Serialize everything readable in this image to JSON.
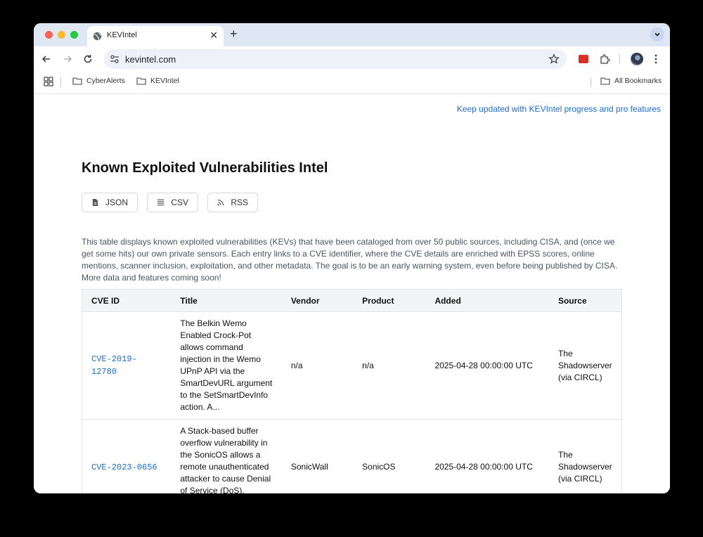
{
  "browser": {
    "tab_title": "KEVIntel",
    "url": "kevintel.com",
    "bookmarks": [
      {
        "label": "CyberAlerts"
      },
      {
        "label": "KEVIntel"
      }
    ],
    "all_bookmarks_label": "All Bookmarks"
  },
  "page": {
    "promo_link": "Keep updated with KEVIntel progress and pro features",
    "title": "Known Exploited Vulnerabilities Intel",
    "buttons": {
      "json": "JSON",
      "csv": "CSV",
      "rss": "RSS"
    },
    "description": "This table displays known exploited vulnerabilities (KEVs) that have been cataloged from over 50 public sources, including CISA, and (once we get some hits) our own private sensors. Each entry links to a CVE identifier, where the CVE details are enriched with EPSS scores, online mentions, scanner inclusion, exploitation, and other metadata. The goal is to be an early warning system, even before being published by CISA. More data and features coming soon!",
    "table": {
      "headers": {
        "cve_id": "CVE ID",
        "title": "Title",
        "vendor": "Vendor",
        "product": "Product",
        "added": "Added",
        "source": "Source"
      },
      "rows": [
        {
          "cve_id": "CVE-2019-12780",
          "title": "The Belkin Wemo Enabled Crock-Pot allows command injection in the Wemo UPnP API via the SmartDevURL argument to the SetSmartDevInfo action. A...",
          "vendor": "n/a",
          "product": "n/a",
          "added": "2025-04-28 00:00:00 UTC",
          "source": "The Shadowserver (via CIRCL)"
        },
        {
          "cve_id": "CVE-2023-0656",
          "title": "A Stack-based buffer overflow vulnerability in the SonicOS allows a remote unauthenticated attacker to cause Denial of Service (DoS), which...",
          "vendor": "SonicWall",
          "product": "SonicOS",
          "added": "2025-04-28 00:00:00 UTC",
          "source": "The Shadowserver (via CIRCL)"
        }
      ]
    }
  }
}
